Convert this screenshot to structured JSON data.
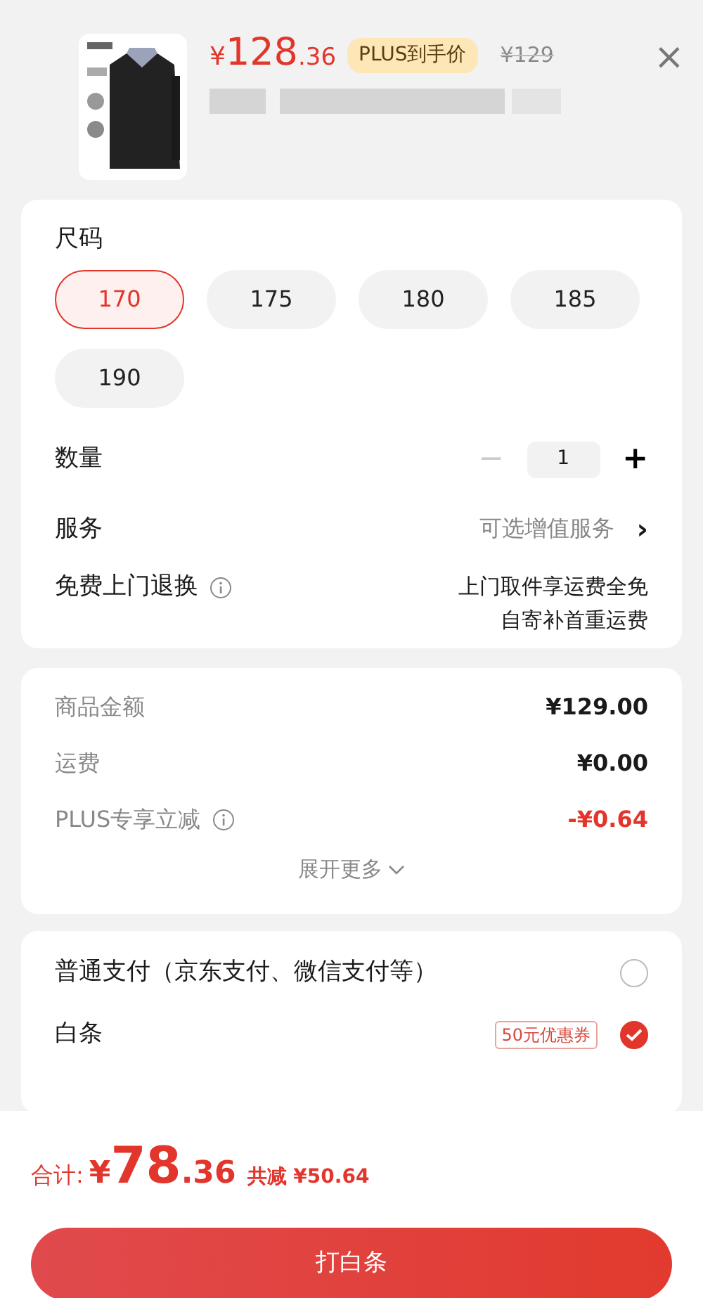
{
  "product": {
    "price_symbol": "¥",
    "price_integer": "128",
    "price_decimal": ".36",
    "price_tag": "PLUS到手价",
    "original_price": "¥129",
    "close": "×"
  },
  "size": {
    "label": "尺码",
    "options": [
      {
        "label": "170",
        "selected": true
      },
      {
        "label": "175",
        "selected": false
      },
      {
        "label": "180",
        "selected": false
      },
      {
        "label": "185",
        "selected": false
      },
      {
        "label": "190",
        "selected": false
      }
    ]
  },
  "quantity": {
    "label": "数量",
    "minus": "−",
    "value": "1",
    "plus": "+",
    "minus_disabled": true
  },
  "service": {
    "label": "服务",
    "value": "可选增值服务",
    "chevron": "›"
  },
  "return_service": {
    "label": "免费上门退换",
    "lines": [
      "上门取件享运费全免",
      "自寄补首重运费"
    ]
  },
  "amounts": {
    "rows": [
      {
        "label": "商品金额",
        "value": "¥129.00",
        "kind": "plain"
      },
      {
        "label": "运费",
        "value": "¥0.00",
        "kind": "plain"
      },
      {
        "label": "PLUS专享立减",
        "value": "-¥0.64",
        "kind": "discount"
      }
    ],
    "more": "展开更多"
  },
  "payment": [
    {
      "label": "普通支付（京东支付、微信支付等）",
      "selected": false
    },
    {
      "label": "白条",
      "coupon": "50元优惠券",
      "selected": true
    }
  ],
  "footer": {
    "total_label": "合计:",
    "total_symbol": "¥",
    "total_integer": "78",
    "total_decimal": ".36",
    "saved": "共减 ¥50.64",
    "button": "打白条"
  }
}
